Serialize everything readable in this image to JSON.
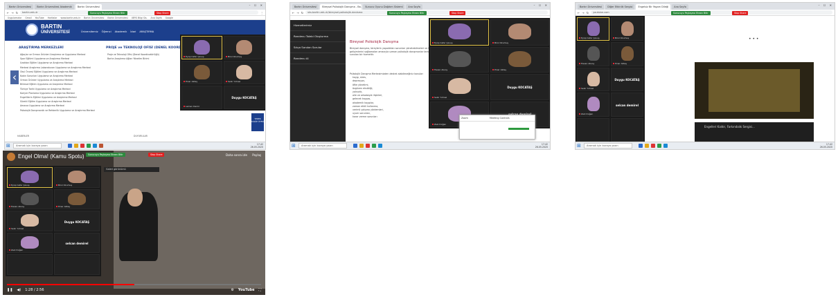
{
  "taskbar": {
    "search_placeholder": "Aramak için buraya yazın",
    "time": "17:42",
    "date": "26.05.2020"
  },
  "shot1": {
    "tabs": [
      "Bartın Üniversitesi",
      "Bartın Üniversitesi Akademik",
      "Bartın Üniversitesi"
    ],
    "url": "bartin.edu.tr",
    "bookmarks": [
      "Uygulamalar",
      "Gmail",
      "YouTube",
      "Haritalar",
      "www.bartin.edu.tr",
      "Bartın Üniversitesi",
      "Bartın Üniversitesi",
      "UBYS Bilgi Sis.",
      "Ana Sayfa",
      "Google"
    ],
    "share_bar": "Sunucuyu Paylaşma Ekranı Bitir",
    "stop_label": "Stop Share",
    "logo_line1": "BARTIN",
    "logo_line2": "ÜNİVERSİTESİ",
    "nav": [
      "Üniversitemiz",
      "Öğrenci",
      "Akademik",
      "İdari",
      "ARAŞTIRMA"
    ],
    "section1_title": "ARAŞTIRMA MERKEZLERİ",
    "section2_title": "PROJE ve TEKNOLOJİ OFİSİ (DENEL KOORDİNATÖRLÜĞÜ)",
    "centers": [
      "Ağaçlar ve Orman Ürünleri Araştırma ve Uygulama Merkezi",
      "Spor Eğitimi Uygulama ve Araştırma Merkezi",
      "Uzaktan Eğitim Uygulama ve Araştırma Merkezi",
      "Merkezi Araştırma Laboratuvarı Uygulama ve Araştırma Merkezi",
      "Okul Öncesi Eğitimi Uygulama ve Araştırma Merkezi",
      "Kadın Sorunları Uygulama ve Araştırma Merkezi",
      "Orman Ürünleri Uygulama ve Araştırma Merkezi",
      "Bilimsel Eğitim Uygulama ve Araştırma Merkezi",
      "Türkiye Tarihi Uygulama ve Araştırma Merkezi",
      "Kariyer Planlama Uygulama ve Araştırma Merkezi",
      "Engellilerin Eğitimi Uygulama ve Araştırma Merkezi",
      "Sürekli Eğitim Uygulama ve Araştırma Merkezi",
      "Amasra Uygulama ve Araştırma Merkezi",
      "Psikolojik Danışmanlık ve Rehberlik Uygulama ve Araştırma Merkezi"
    ],
    "office_items": [
      "Proje ve Teknoloji Ofisi (Denel Koordinatörlüğü)",
      "Bartın Araştırma Ağları Yönetim Birimi"
    ],
    "side_badge": "YEDEK KULÜP ÜYESİ",
    "footer": [
      "HABERLER",
      "DUYURULAR"
    ]
  },
  "shot2": {
    "tabs": [
      "Bartın Üniversitesi",
      "Bireysel Psikolojik Danışma - Ba...",
      "Sunucu Oyunu Dağıtım Sistemi",
      "Ana Sayfa"
    ],
    "url": "sks.bartin.edu.tr/bireysel-psikolojik-danisma",
    "share_bar": "Sunucuyu Paylaşma Ekranı Bitir",
    "stop_label": "Stop Share",
    "side_menu": [
      "Hizmetlerimiz",
      "Randevu Talebi Oluşturma",
      "Sıkça Sorulan Sorular",
      "Randevu Al"
    ],
    "title": "Bireysel Psikolojik Danışma",
    "paragraph": "Bireysel danışma, bireylerin yaşadıkları sorunları yönetebilmeleri ve kişisel gelişimlerini sağlamaları amacıyla uzman psikolojik danışmanlar tarafından sunulan bir hizmettir.",
    "list_title": "Psikolojik Danışma Merkezimizden destek alabileceğiniz konular:",
    "list": [
      "kaygı, stres,",
      "depresyon,",
      "öfke yönetimi,",
      "özgüven eksikliği,",
      "yalnızlık,",
      "aile ve arkadaşlık ilişkileri,",
      "gelecek kaygısı,",
      "akademik kaygılar,",
      "zaman etkili kullanma,",
      "verimli çalışma yöntemleri,",
      "uyum sorunları,",
      "karar verme sorunları"
    ],
    "popup_title": "Zoom",
    "popup_label": "Meeting Controls"
  },
  "shot3": {
    "tabs": [
      "Bartın Üniversitesi",
      "Diğer Etkinlik Sergisi",
      "Engelsiz Bir Yaşam Dileği",
      "Ana Sayfa"
    ],
    "url": "youtube.com",
    "share_bar": "Sunucuyu Paylaşma Ekranı Bitir",
    "stop_label": "Stop Share",
    "video_card_title": "Engelleri Kaldır, Farkındalık Sergisi..."
  },
  "zoom": {
    "participants": [
      "Eyüp Cafer Çavuş",
      "Birol Okumuş",
      "Pınar Aktaş",
      "Hasan Aksoy",
      "Leman Demir",
      "Selin Yılmaz",
      "Duygu KOCATAŞ",
      "Zeki Doğan",
      "selcan demirel"
    ],
    "view_label": "Galeri görünümü"
  },
  "shot4": {
    "title": "Engel Olma! (Kamu Spotu)",
    "top_right": [
      "Daha sonra izle",
      "Paylaş"
    ],
    "time": "1:28 / 2:56",
    "progress": 0.5,
    "logo": "YouTube"
  }
}
